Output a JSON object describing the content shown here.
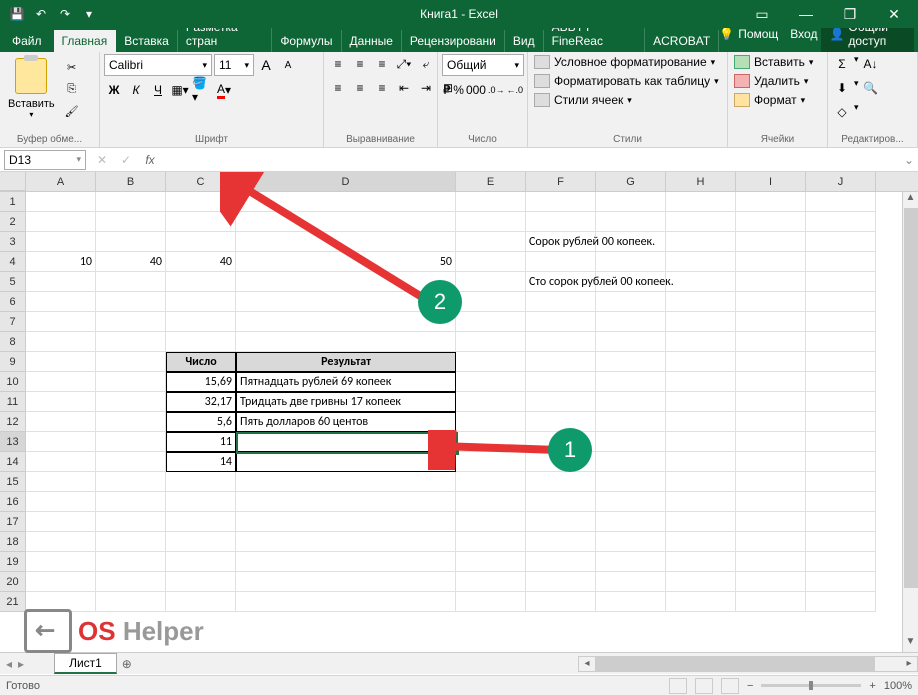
{
  "title": "Книга1 - Excel",
  "qat": {
    "save": "💾",
    "undo": "↶",
    "redo": "↷"
  },
  "window": {
    "ribbon_opts": "▭",
    "min": "—",
    "max": "❐",
    "close": "✕"
  },
  "tabs": {
    "file": "Файл",
    "list": [
      "Главная",
      "Вставка",
      "Разметка стран",
      "Формулы",
      "Данные",
      "Рецензировани",
      "Вид",
      "ABBYY FineReac",
      "ACROBAT"
    ],
    "active": 0,
    "help": "Помощ",
    "signin": "Вход",
    "share": "Общий доступ"
  },
  "ribbon": {
    "clipboard": {
      "paste": "Вставить",
      "label": "Буфер обме..."
    },
    "font": {
      "name": "Calibri",
      "size": "11",
      "label": "Шрифт",
      "bold": "Ж",
      "italic": "К",
      "underline": "Ч",
      "grow": "A",
      "shrink": "A"
    },
    "align": {
      "label": "Выравнивание",
      "wrap": "⤶",
      "merge": "⊞"
    },
    "number": {
      "format": "Общий",
      "label": "Число",
      "currency": "₽",
      "percent": "%",
      "comma": "000",
      "inc": ".0",
      "dec": ".0"
    },
    "styles": {
      "label": "Стили",
      "cond": "Условное форматирование",
      "table": "Форматировать как таблицу",
      "cell": "Стили ячеек"
    },
    "cells": {
      "label": "Ячейки",
      "insert": "Вставить",
      "delete": "Удалить",
      "format": "Формат"
    },
    "editing": {
      "label": "Редактиров...",
      "sum": "Σ",
      "fill": "⬇",
      "clear": "◇",
      "sort": "A↓",
      "find": "🔍"
    }
  },
  "formula": {
    "namebox": "D13",
    "fx": "fx",
    "value": ""
  },
  "columns": [
    "A",
    "B",
    "C",
    "D",
    "E",
    "F",
    "G",
    "H",
    "I",
    "J"
  ],
  "cells": {
    "F3": "Сорок рублей  00 копеек.",
    "A4": "10",
    "B4": "40",
    "C4": "40",
    "D4": "50",
    "F5": "Сто сорок рублей  00 копеек.",
    "C9": "Число",
    "D9": "Результат",
    "C10": "15,69",
    "D10": "Пятнадцать рублей 69 копеек",
    "C11": "32,17",
    "D11": "Тридцать две гривны 17 копеек",
    "C12": "5,6",
    "D12": "Пять долларов 60 центов",
    "C13": "11",
    "D13": "",
    "C14": "14"
  },
  "chart_data": {
    "type": "table",
    "title": "",
    "columns": [
      "Число",
      "Результат"
    ],
    "rows": [
      [
        "15,69",
        "Пятнадцать рублей 69 копеек"
      ],
      [
        "32,17",
        "Тридцать две гривны 17 копеек"
      ],
      [
        "5,6",
        "Пять долларов 60 центов"
      ],
      [
        "11",
        ""
      ],
      [
        "14",
        ""
      ]
    ]
  },
  "sheet": {
    "name": "Лист1"
  },
  "status": {
    "ready": "Готово",
    "zoom": "100%"
  },
  "annotations": {
    "step1": "1",
    "step2": "2"
  },
  "watermark": {
    "os": "OS",
    "helper": "Helper"
  }
}
